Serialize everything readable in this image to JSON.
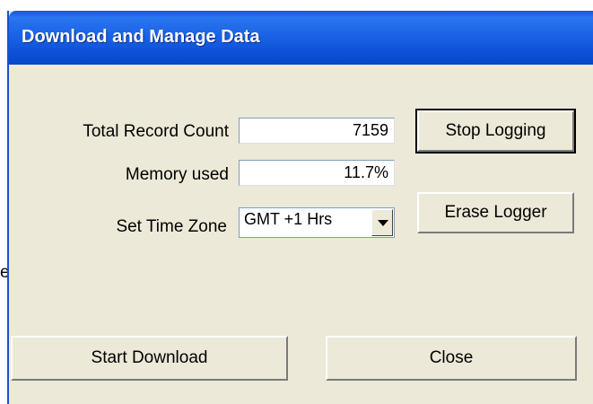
{
  "window": {
    "title": "Download and Manage Data"
  },
  "fields": {
    "total_record_count": {
      "label": "Total Record Count",
      "value": "7159"
    },
    "memory_used": {
      "label": "Memory used",
      "value": "11.7%"
    },
    "time_zone": {
      "label": "Set Time Zone",
      "selected": "GMT +1 Hrs"
    }
  },
  "buttons": {
    "stop_logging": "Stop Logging",
    "erase_logger": "Erase Logger",
    "start_download": "Start Download",
    "close": "Close"
  },
  "background": {
    "stray_text": "e"
  },
  "colors": {
    "title_bar": "#0c4fd6",
    "client_bg": "#ece9d8",
    "title_text": "#ffffff"
  },
  "icons": {
    "dropdown_arrow": "chevron-down-icon"
  }
}
